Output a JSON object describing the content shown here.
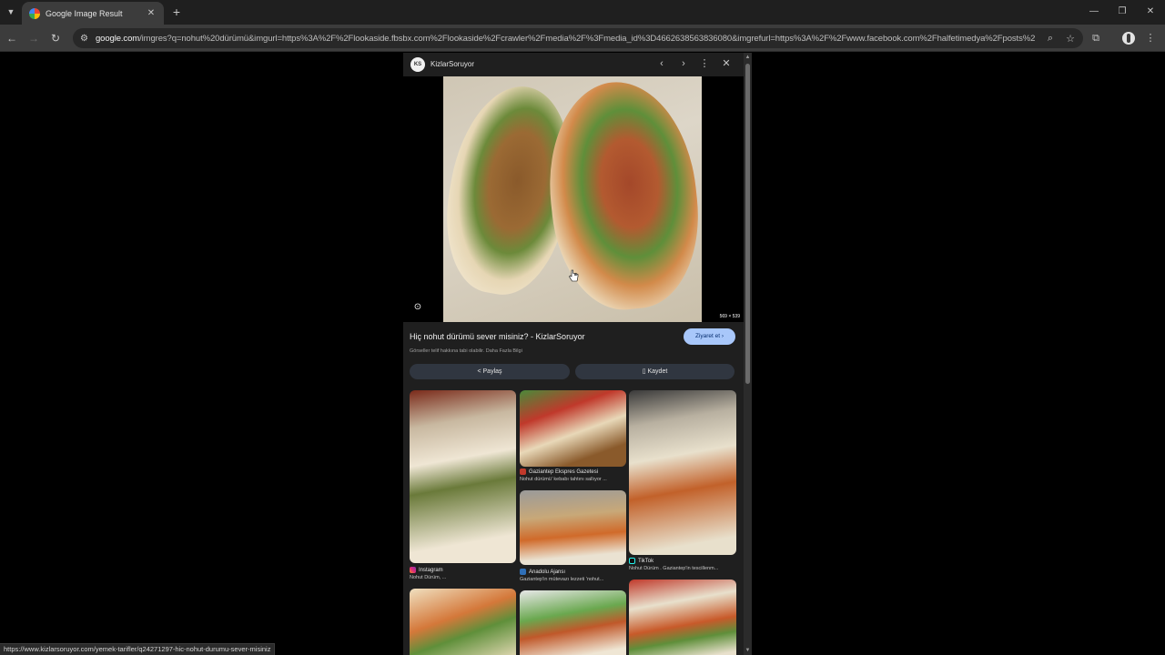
{
  "browser": {
    "tab_title": "Google Image Result",
    "url_host": "google.com",
    "url_rest": "/imgres?q=nohut%20dürümü&imgurl=https%3A%2F%2Flookaside.fbsbx.com%2Flookaside%2Fcrawler%2Fmedia%2F%3Fmedia_id%3D4662638563836080&imgrefurl=https%3A%2F%2Fwww.facebook.com%2Fhalfetimedya%2Fposts%2Fno...",
    "status_url": "https://www.kizlarsoruyor.com/yemek-tarifler/q24271297-hic-nohut-durumu-sever-misiniz"
  },
  "viewer": {
    "source_name": "KizlarSoruyor",
    "source_avatar": "KS",
    "image_dims": "569 × 539",
    "title": "Hiç nohut dürümü sever misiniz? - KizlarSoruyor",
    "visit_label": "Ziyaret et",
    "copyright": "Görseller telif hakkına tabi olabilir. Daha Fazla Bilgi",
    "share_label": "Paylaş",
    "save_label": "Kaydet"
  },
  "related": [
    {
      "source": "Instagram",
      "text": "Nohut Dürüm, ..."
    },
    {
      "source": "Gaziantep Ekspres Gazetesi",
      "text": "Nohut dürümü' kebabı tahtını sallıyor ..."
    },
    {
      "source": "Anadolu Ajansı",
      "text": "Gaziantep'in mütevazı lezzeti 'nohut..."
    },
    {
      "source": "TikTok",
      "text": "Nohut Dürüm . Gaziantep'in tescillenm..."
    }
  ],
  "colors": {
    "accent": "#a8c7fa",
    "panel_bg": "#1f1f1f",
    "page_bg": "#000000"
  }
}
